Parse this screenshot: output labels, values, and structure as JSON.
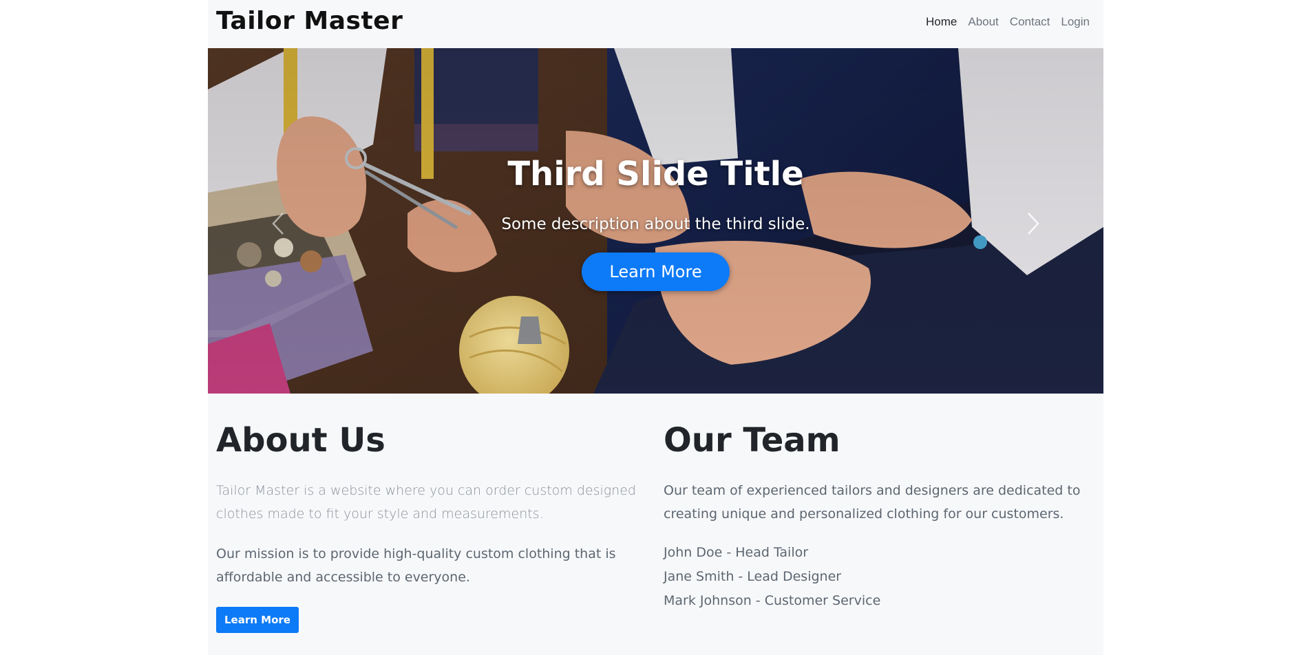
{
  "brand": "Tailor Master",
  "nav": {
    "home": "Home",
    "about": "About",
    "contact": "Contact",
    "login": "Login"
  },
  "carousel": {
    "title": "Third Slide Title",
    "description": "Some description about the third slide.",
    "button_label": "Learn More",
    "prev_icon": "chevron-left-icon",
    "next_icon": "chevron-right-icon"
  },
  "about": {
    "heading": "About Us",
    "lead": "Tailor Master is a website where you can order custom designed clothes made to fit your style and measurements.",
    "mission": "Our mission is to provide high-quality custom clothing that is affordable and accessible to everyone.",
    "button_label": "Learn More"
  },
  "team": {
    "heading": "Our Team",
    "intro": "Our team of experienced tailors and designers are dedicated to creating unique and personalized clothing for our customers.",
    "members": [
      "John Doe - Head Tailor",
      "Jane Smith - Lead Designer",
      "Mark Johnson - Customer Service"
    ]
  },
  "colors": {
    "accent": "#0d7af7",
    "page_bg": "#f7f8fa",
    "heading": "#212529",
    "muted": "#6c757d"
  }
}
